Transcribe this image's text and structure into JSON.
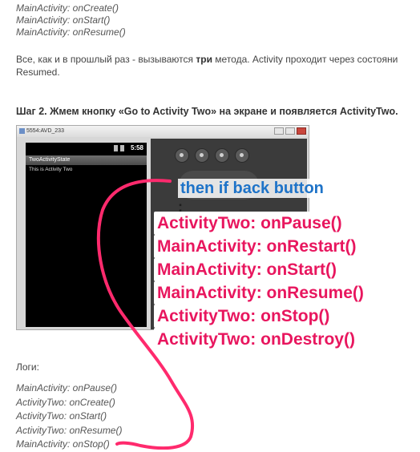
{
  "top_log": [
    "MainActivity: onCreate()",
    "MainActivity: onStart()",
    "MainActivity: onResume()"
  ],
  "paragraph": {
    "line1_before": "Все, как и в прошлый раз - вызываются ",
    "line1_bold": "три",
    "line1_after": " метода. Activity проходит через состояни",
    "line2": "Resumed."
  },
  "step_heading": "Шаг 2. Жмем кнопку «Go to Activity Two» на экране и появляется ActivityTwo.",
  "emulator": {
    "window_title": "5554:AVD_233",
    "clock": "5:58",
    "app_title": "TwoActivityState",
    "app_text": "This is Activity Two"
  },
  "annotation": {
    "heading": "then if back button",
    "colon": ":",
    "lines": [
      "ActivityTwo: onPause()",
      "MainActivity: onRestart()",
      "MainActivity: onStart()",
      "MainActivity: onResume()",
      "ActivityTwo: onStop()",
      "ActivityTwo: onDestroy()"
    ],
    "pen_color": "#ff2a6d"
  },
  "logs_label": "Логи:",
  "bottom_log": [
    "MainActivity: onPause()",
    "ActivityTwo: onCreate()",
    "ActivityTwo: onStart()",
    "ActivityTwo: onResume()",
    "MainActivity: onStop()"
  ]
}
